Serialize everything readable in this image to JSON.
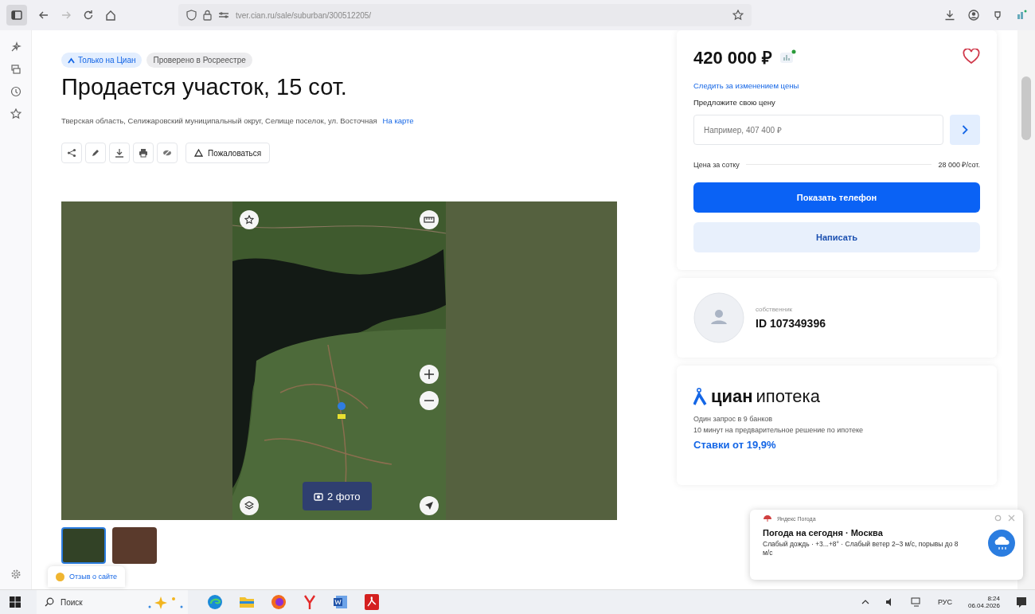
{
  "browser": {
    "url": "tver.cian.ru/sale/suburban/300512205/"
  },
  "badges": [
    {
      "label": "Только на Циан",
      "kind": "brand"
    },
    {
      "label": "Проверено в Росреестре",
      "kind": "plain"
    }
  ],
  "title": "Продается участок, 15 сот.",
  "address": "Тверская область, Селижаровский муниципальный округ, Селище поселок, ул. Восточная",
  "map_link": "На карте",
  "complain_button": "Пожаловаться",
  "gallery": {
    "photos_button": "2 фото",
    "thumbnails": [
      {
        "selected": true
      },
      {
        "selected": false
      }
    ]
  },
  "price": {
    "value": "420 000 ₽",
    "favorite": false,
    "watch_link": "Следить за изменением цены",
    "offer_label": "Предложите свою цену",
    "offer_placeholder": "Например, 407 400 ₽",
    "per_unit_label": "Цена за сотку",
    "per_unit_value": "28 000 ₽/сот."
  },
  "buttons": [
    {
      "label": "Показать телефон",
      "kind": "primary"
    },
    {
      "label": "Написать",
      "kind": "secondary"
    }
  ],
  "owner": {
    "role": "собственник",
    "id": "ID 107349396"
  },
  "mortgage": {
    "brand": "циан",
    "suffix": "ипотека",
    "lines": [
      "Один запрос в 9 банков",
      "10 минут на предварительное решение по ипотеке"
    ],
    "link": "Ставки от 19,9%"
  },
  "feedback": "Отзыв о сайте",
  "notification": {
    "source": "Яндекс Погода",
    "title": "Погода на сегодня · Москва",
    "text": "Слабый дождь · +3...+8° · Слабый ветер 2–3 м/с, порывы до 8 м/с"
  },
  "taskbar": {
    "search": "Поиск",
    "language": "РУС",
    "time": "8:24",
    "date": "06.04.2026"
  }
}
